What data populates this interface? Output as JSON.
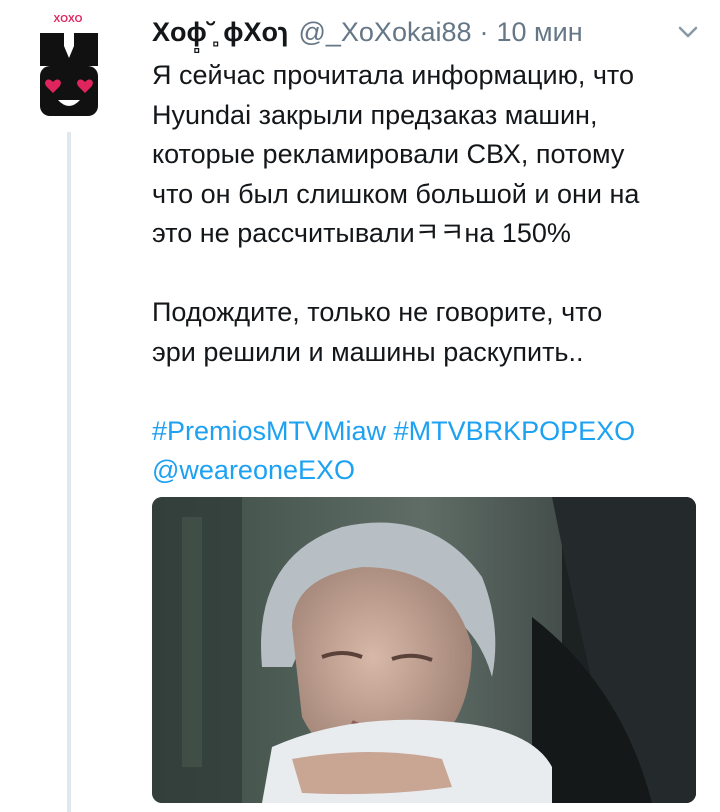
{
  "tweet": {
    "display_name": "Xoɸ̻˘̻ ɸXoɿ",
    "handle": "@_XoXokai88",
    "separator": "·",
    "time": "10 мин",
    "text_line_1": "Я сейчас прочитала информацию, что",
    "text_line_2": "Hyundai закрыли предзаказ машин,",
    "text_line_3": "которые рекламировали СВХ, потому",
    "text_line_4": "что он был слишком большой и они на",
    "text_line_5": "это не рассчитывалиㅋㅋна 150%",
    "text_line_6": "Подождите, только не говорите, что",
    "text_line_7": "эри решили и машины раскупить..",
    "hashtag_1": "#PremiosMTVMiaw",
    "hashtag_2": "#MTVBRKPOPEXO",
    "mention": "@weareoneEXO"
  },
  "avatar": {
    "logo_text": "XOXO"
  },
  "icons": {
    "menu": "chevron-down-icon"
  },
  "colors": {
    "link": "#1da1f2",
    "secondary_text": "#657786",
    "thread_line": "#e1e8ed",
    "logo_red": "#e0245e"
  }
}
